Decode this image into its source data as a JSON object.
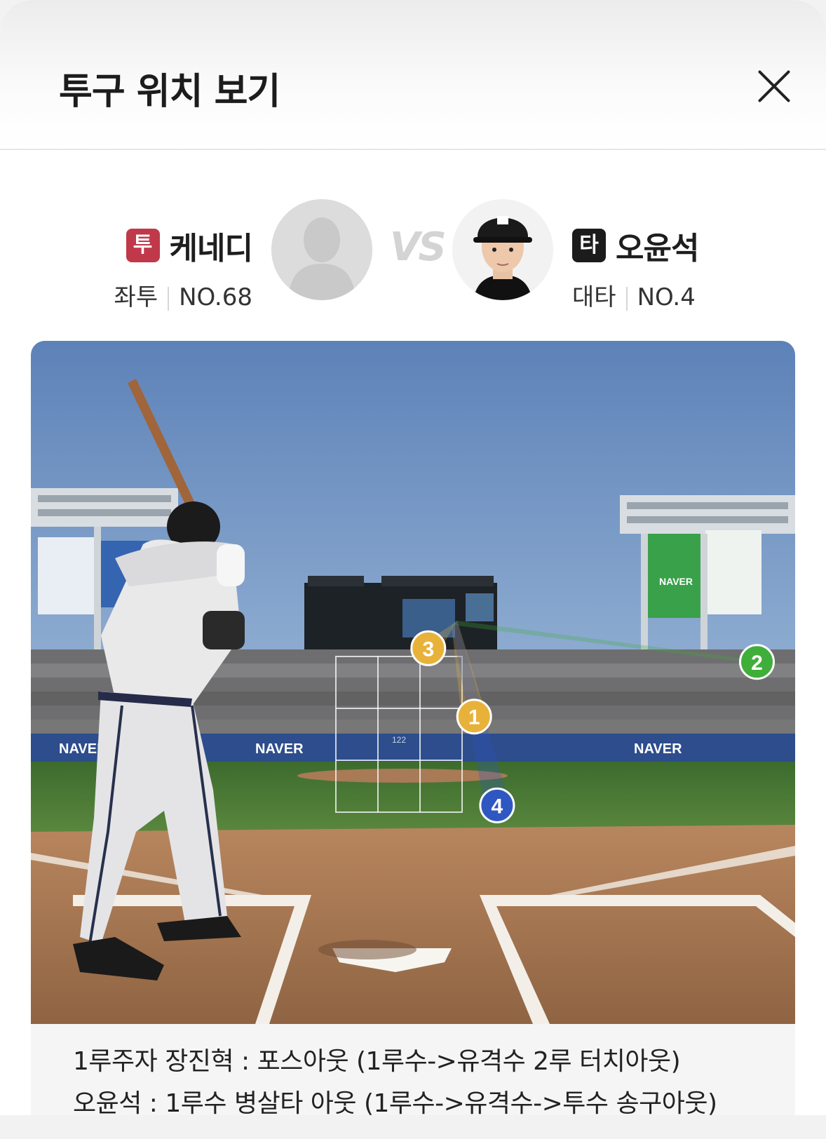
{
  "header": {
    "title": "투구 위치 보기",
    "close_icon": "close-icon"
  },
  "matchup": {
    "pitcher": {
      "role_badge": "투",
      "role_color": "#c0394b",
      "name": "케네디",
      "hand": "좌투",
      "number": "NO.68"
    },
    "vs": "VS",
    "batter": {
      "role_badge": "타",
      "role_color": "#1c1c1c",
      "name": "오윤석",
      "position": "대타",
      "number": "NO.4"
    }
  },
  "field": {
    "pitch_speed_readout": "122",
    "ad_text": "NAVER",
    "pitches": [
      {
        "label": "1",
        "color": "#e8b23a",
        "zone_x": 0.58,
        "zone_y": 0.55
      },
      {
        "label": "2",
        "color": "#3fae3a",
        "zone_x": 0.95,
        "zone_y": 0.47
      },
      {
        "label": "3",
        "color": "#e8b23a",
        "zone_x": 0.52,
        "zone_y": 0.45
      },
      {
        "label": "4",
        "color": "#2e57c2",
        "zone_x": 0.61,
        "zone_y": 0.68
      }
    ]
  },
  "result": {
    "line1": "1루주자 장진혁 : 포스아웃 (1루수->유격수 2루 터치아웃)",
    "line2": "오윤석 : 1루수 병살타 아웃 (1루수->유격수->투수 송구아웃)"
  }
}
